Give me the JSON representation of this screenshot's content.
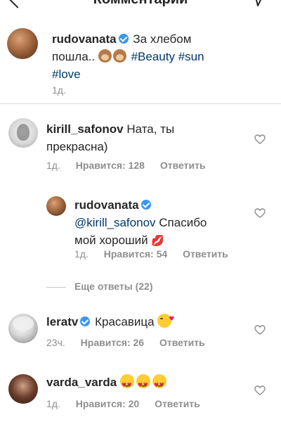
{
  "header": {
    "title": "Комментарии"
  },
  "caption": {
    "username": "rudovanata",
    "text_line1": "За хлебом",
    "text_line2_prefix": "пошла..",
    "hashtag1": "#Beauty",
    "hashtag2": "#sun",
    "hashtag3": "#love",
    "time": "1д."
  },
  "comments": [
    {
      "username": "kirill_safonov",
      "text_line1": "Ната, ты",
      "text_line2": "прекрасна)",
      "time": "1д.",
      "likes": "Нравится: 128",
      "reply": "Ответить"
    },
    {
      "username": "rudovanata",
      "mention": "@kirill_safonov",
      "text_line1_rest": "Спасибо",
      "text_line2": "мой хороший",
      "time": "1д.",
      "likes": "Нравится: 54",
      "reply": "Ответить"
    },
    {
      "username": "leratv",
      "text": "Красавица",
      "time": "23ч.",
      "likes": "Нравится: 26",
      "reply": "Ответить"
    },
    {
      "username": "varda_varda",
      "time": "1д.",
      "likes": "Нравится: 20",
      "reply": "Ответить"
    }
  ],
  "more_replies": "Еще ответы (22)"
}
